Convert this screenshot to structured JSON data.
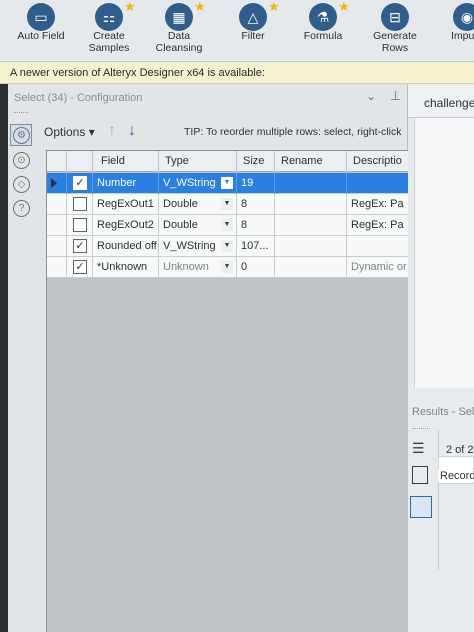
{
  "ribbon": {
    "tools": [
      {
        "label": "Auto Field",
        "icon": "auto-field-icon",
        "glyph": "▭",
        "star": false
      },
      {
        "label": "Create\nSamples",
        "icon": "create-samples-icon",
        "glyph": "⚏",
        "star": true
      },
      {
        "label": "Data\nCleansing",
        "icon": "data-cleansing-icon",
        "glyph": "▦",
        "star": true
      },
      {
        "label": "Filter",
        "icon": "filter-icon",
        "glyph": "△",
        "star": true
      },
      {
        "label": "Formula",
        "icon": "formula-icon",
        "glyph": "⚗",
        "star": true
      },
      {
        "label": "Generate\nRows",
        "icon": "generate-rows-icon",
        "glyph": "⊟",
        "star": false
      },
      {
        "label": "Imputa",
        "icon": "imputation-icon",
        "glyph": "◉",
        "star": false
      }
    ]
  },
  "banner": {
    "text": "A newer version of Alteryx Designer x64 is available:"
  },
  "config": {
    "title": "Select (34) - Configuration",
    "options_label": "Options",
    "tip": "TIP: To reorder multiple rows: select, right-click",
    "columns": [
      "Field",
      "Type",
      "Size",
      "Rename",
      "Descriptio"
    ],
    "rows": [
      {
        "checked": true,
        "field": "Number",
        "type": "V_WString",
        "size": "19",
        "rename": "",
        "description": "",
        "selected": true
      },
      {
        "checked": false,
        "field": "RegExOut1",
        "type": "Double",
        "size": "8",
        "rename": "",
        "description": "RegEx: Pa",
        "selected": false
      },
      {
        "checked": false,
        "field": "RegExOut2",
        "type": "Double",
        "size": "8",
        "rename": "",
        "description": "RegEx: Pa",
        "selected": false
      },
      {
        "checked": true,
        "field": "Rounded off",
        "type": "V_WString",
        "size": "107...",
        "rename": "",
        "description": "",
        "selected": false
      },
      {
        "checked": true,
        "field": "*Unknown",
        "type": "Unknown",
        "size": "0",
        "rename": "",
        "description": "Dynamic or",
        "selected": false,
        "muted": true
      }
    ]
  },
  "canvas": {
    "tab_label": "challenge"
  },
  "results": {
    "title": "Results - Sele",
    "record_count": "2 of 2",
    "record_label": "Record"
  },
  "colors": {
    "selected_row": "#2a7fe0",
    "banner": "#f4f1cf",
    "star": "#f2b705"
  }
}
